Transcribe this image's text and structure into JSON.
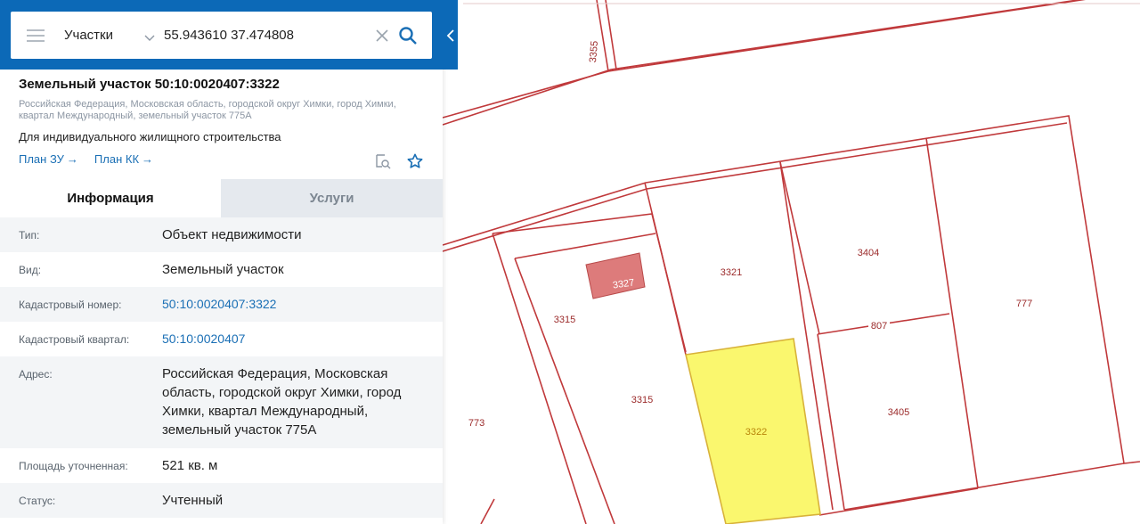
{
  "search": {
    "type_label": "Участки",
    "query": "55.943610 37.474808"
  },
  "object": {
    "title": "Земельный участок 50:10:0020407:3322",
    "address": "Российская Федерация, Московская область, городской округ Химки, город Химки, квартал Международный, земельный участок 775А",
    "purpose": "Для индивидуального жилищного строительства",
    "plan_links": [
      {
        "label": "План ЗУ",
        "arrow": "→"
      },
      {
        "label": "План КК",
        "arrow": "→"
      }
    ]
  },
  "tabs": [
    {
      "label": "Информация",
      "active": true
    },
    {
      "label": "Услуги",
      "active": false
    }
  ],
  "info": [
    {
      "key": "Тип:",
      "value": "Объект недвижимости"
    },
    {
      "key": "Вид:",
      "value": "Земельный участок"
    },
    {
      "key": "Кадастровый номер:",
      "value": "50:10:0020407:3322",
      "link": true
    },
    {
      "key": "Кадастровый квартал:",
      "value": "50:10:0020407",
      "link": true
    },
    {
      "key": "Адрес:",
      "value": "Российская Федерация, Московская область, городской округ Химки, город Химки, квартал Международный, земельный участок 775А"
    },
    {
      "key": "Площадь уточненная:",
      "value": "521 кв. м"
    },
    {
      "key": "Статус:",
      "value": "Учтенный"
    }
  ],
  "map": {
    "plot_labels": [
      "3355",
      "3327",
      "3321",
      "3404",
      "777",
      "3315",
      "807",
      "3315",
      "3405",
      "773",
      "3322"
    ],
    "colors": {
      "boundary": "#c0393b",
      "selected_fill": "#faf76e",
      "selected_stroke": "#d8b23a",
      "building_fill": "#dd7b7b"
    }
  },
  "colors": {
    "header": "#0c69b7",
    "link": "#1a6fb5"
  },
  "icons": {
    "menu": "menu-icon",
    "dropdown": "chevron-down-icon",
    "clear": "close-icon",
    "search": "search-icon",
    "collapse": "chevron-left-icon",
    "preview": "document-search-icon",
    "favorite": "star-icon"
  }
}
